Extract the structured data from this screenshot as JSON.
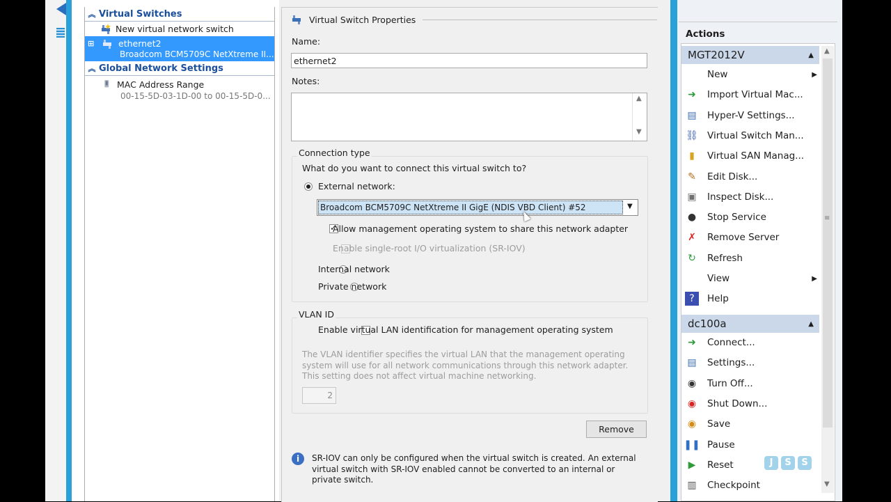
{
  "tree": {
    "virtual_switches_header": "Virtual Switches",
    "new_switch": "New virtual network switch",
    "switch_name": "ethernet2",
    "switch_adapter": "Broadcom BCM5709C NetXtreme II...",
    "global_header": "Global Network Settings",
    "mac_range_label": "MAC Address Range",
    "mac_range_value": "00-15-5D-03-1D-00 to 00-15-5D-0..."
  },
  "props": {
    "title": "Virtual Switch Properties",
    "name_label": "Name:",
    "name_value": "ethernet2",
    "notes_label": "Notes:",
    "notes_value": "",
    "connection_type_label": "Connection type",
    "connection_question": "What do you want to connect this virtual switch to?",
    "external_label": "External network:",
    "adapter_selected": "Broadcom BCM5709C NetXtreme II GigE (NDIS VBD Client) #52",
    "allow_mgmt_label": "Allow management operating system to share this network adapter",
    "sriov_label": "Enable single-root I/O virtualization (SR-IOV)",
    "internal_label": "Internal network",
    "private_label": "Private network",
    "vlan_label": "VLAN ID",
    "vlan_enable_label": "Enable virtual LAN identification for management operating system",
    "vlan_desc": "The VLAN identifier specifies the virtual LAN that the management operating system will use for all network communications through this network adapter. This setting does not affect virtual machine networking.",
    "vlan_value": "2",
    "remove_button": "Remove",
    "info_text": "SR-IOV can only be configured when the virtual switch is created. An external virtual switch with SR-IOV enabled cannot be converted to an internal or private switch."
  },
  "actions": {
    "title": "Actions",
    "server_header": "MGT2012V",
    "server_items": [
      {
        "label": "New",
        "icon": "blank-icon",
        "submenu": true
      },
      {
        "label": "Import Virtual Mac...",
        "icon": "import-icon"
      },
      {
        "label": "Hyper-V Settings...",
        "icon": "settings-icon"
      },
      {
        "label": "Virtual Switch Man...",
        "icon": "switch-icon"
      },
      {
        "label": "Virtual SAN Manag...",
        "icon": "san-icon"
      },
      {
        "label": "Edit Disk...",
        "icon": "edit-disk-icon"
      },
      {
        "label": "Inspect Disk...",
        "icon": "inspect-disk-icon"
      },
      {
        "label": "Stop Service",
        "icon": "stop-icon"
      },
      {
        "label": "Remove Server",
        "icon": "remove-icon"
      },
      {
        "label": "Refresh",
        "icon": "refresh-icon"
      },
      {
        "label": "View",
        "icon": "blank-icon",
        "submenu": true
      },
      {
        "label": "Help",
        "icon": "help-icon"
      }
    ],
    "vm_header": "dc100a",
    "vm_items": [
      {
        "label": "Connect...",
        "icon": "connect-icon"
      },
      {
        "label": "Settings...",
        "icon": "vm-settings-icon"
      },
      {
        "label": "Turn Off...",
        "icon": "turn-off-icon"
      },
      {
        "label": "Shut Down...",
        "icon": "shutdown-icon"
      },
      {
        "label": "Save",
        "icon": "save-icon"
      },
      {
        "label": "Pause",
        "icon": "pause-icon"
      },
      {
        "label": "Reset",
        "icon": "reset-icon"
      },
      {
        "label": "Checkpoint",
        "icon": "checkpoint-icon"
      }
    ]
  },
  "watermark": "JSS",
  "colors": {
    "accent": "#29a0d8",
    "selection": "#3399ff",
    "section_header": "#1b4f9c",
    "actions_header": "#cbd8ea"
  }
}
